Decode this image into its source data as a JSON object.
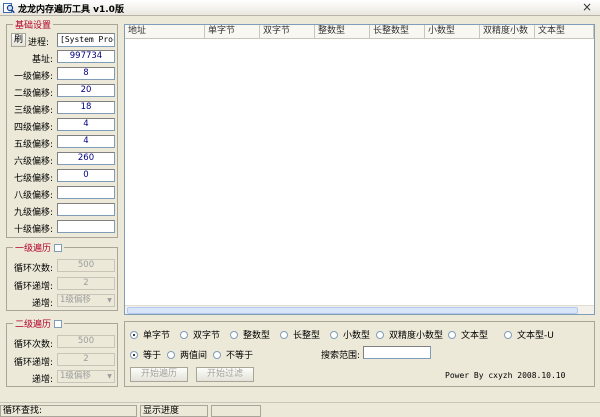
{
  "window": {
    "title": "龙龙内存遍历工具 v1.0版",
    "close": "×"
  },
  "base": {
    "title": "基础设置",
    "refresh_label": "刷",
    "process_label": "进程:",
    "process_value": "[System Proc",
    "base_addr_label": "基址:",
    "base_addr_value": "997734",
    "offsets": [
      {
        "label": "一级偏移:",
        "value": "8"
      },
      {
        "label": "二级偏移:",
        "value": "20"
      },
      {
        "label": "三级偏移:",
        "value": "18"
      },
      {
        "label": "四级偏移:",
        "value": "4"
      },
      {
        "label": "五级偏移:",
        "value": "4"
      },
      {
        "label": "六级偏移:",
        "value": "260"
      },
      {
        "label": "七级偏移:",
        "value": "0"
      },
      {
        "label": "八级偏移:",
        "value": ""
      },
      {
        "label": "九级偏移:",
        "value": ""
      },
      {
        "label": "十级偏移:",
        "value": ""
      }
    ]
  },
  "loop1": {
    "title": "一级遍历",
    "count_label": "循环次数:",
    "count_value": "500",
    "step_label": "循环递增:",
    "step_value": "2",
    "inc_label": "递增:",
    "inc_value": "1级偏移"
  },
  "loop2": {
    "title": "二级遍历",
    "count_label": "循环次数:",
    "count_value": "500",
    "step_label": "循环递增:",
    "step_value": "2",
    "inc_label": "递增:",
    "inc_value": "1级偏移"
  },
  "list": {
    "columns": [
      "地址",
      "单字节",
      "双字节",
      "整数型",
      "长整数型",
      "小数型",
      "双精度小数",
      "文本型"
    ]
  },
  "types": [
    "单字节",
    "双字节",
    "整数型",
    "长整型",
    "小数型",
    "双精度小数型",
    "文本型",
    "文本型-U"
  ],
  "selected_type": 0,
  "compare": [
    "等于",
    "两值间",
    "不等于"
  ],
  "selected_compare": 0,
  "range_label": "搜索范围:",
  "range_value": "",
  "start_button": "开始遍历",
  "filter_button": "开始过滤",
  "credit": "Power By cxyzh 2008.10.10",
  "status": {
    "loop_label": "循环查找:",
    "progress_label": "显示进度"
  }
}
